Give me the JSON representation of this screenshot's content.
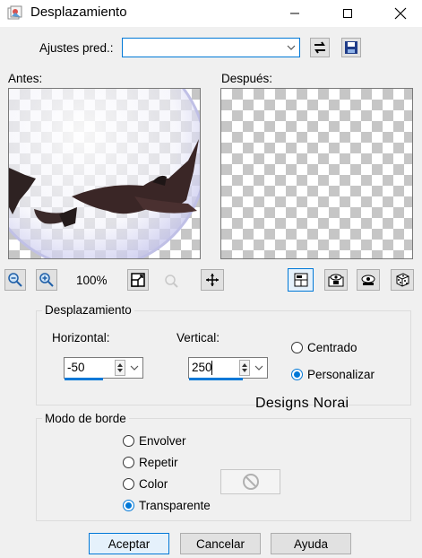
{
  "window": {
    "title": "Desplazamiento",
    "controls": {
      "minimize_icon": "minimize-icon",
      "maximize_icon": "maximize-icon",
      "close_icon": "close-icon"
    }
  },
  "presets": {
    "label": "Ajustes pred.:",
    "value": ""
  },
  "previews": {
    "before_label": "Antes:",
    "after_label": "Después:",
    "zoom": "100%"
  },
  "offset": {
    "group_title": "Desplazamiento",
    "horizontal_label": "Horizontal:",
    "horizontal_value": "-50",
    "vertical_label": "Vertical:",
    "vertical_value": "250",
    "centered_label": "Centrado",
    "custom_label": "Personalizar",
    "selected": "Personalizar"
  },
  "watermark": "Designs Norai",
  "edge_mode": {
    "group_title": "Modo de borde",
    "options": [
      "Envolver",
      "Repetir",
      "Color",
      "Transparente"
    ],
    "selected": "Transparente"
  },
  "buttons": {
    "ok": "Aceptar",
    "cancel": "Cancelar",
    "help": "Ayuda"
  },
  "colors": {
    "accent": "#0078d7",
    "background": "#f0f0f0"
  }
}
